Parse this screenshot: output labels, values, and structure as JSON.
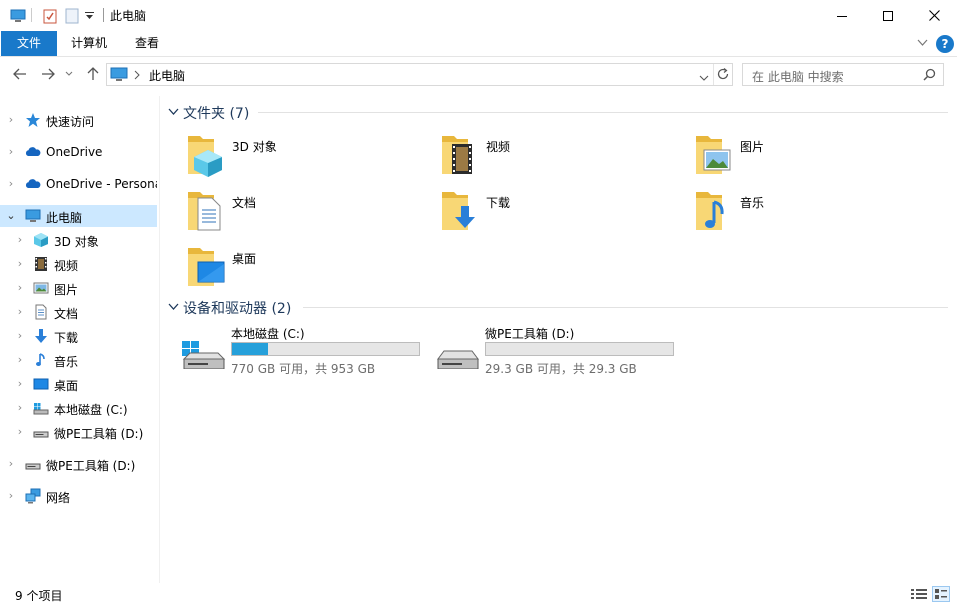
{
  "window": {
    "title": "此电脑",
    "controls": [
      "minimize-icon",
      "maximize-icon",
      "close-icon"
    ]
  },
  "ribbon": {
    "tabs": [
      {
        "label": "文件",
        "active": true
      },
      {
        "label": "计算机",
        "active": false
      },
      {
        "label": "查看",
        "active": false
      }
    ],
    "help_label": "?"
  },
  "address": {
    "location": "此电脑",
    "search_placeholder": "在 此电脑 中搜索"
  },
  "navpane": {
    "items": [
      {
        "label": "快速访问",
        "icon": "star-icon"
      },
      {
        "label": "OneDrive",
        "icon": "cloud-icon"
      },
      {
        "label": "OneDrive - Personal",
        "icon": "cloud-icon"
      },
      {
        "label": "此电脑",
        "icon": "computer-icon",
        "selected": true
      },
      {
        "label": "3D 对象",
        "icon": "cube-icon"
      },
      {
        "label": "视频",
        "icon": "film-icon"
      },
      {
        "label": "图片",
        "icon": "picture-icon"
      },
      {
        "label": "文档",
        "icon": "document-icon"
      },
      {
        "label": "下载",
        "icon": "download-arrow-icon"
      },
      {
        "label": "音乐",
        "icon": "music-note-icon"
      },
      {
        "label": "桌面",
        "icon": "desktop-icon"
      },
      {
        "label": "本地磁盘 (C:)",
        "icon": "windows-drive-icon"
      },
      {
        "label": "微PE工具箱 (D:)",
        "icon": "drive-icon"
      },
      {
        "label": "微PE工具箱 (D:)",
        "icon": "drive-icon"
      },
      {
        "label": "网络",
        "icon": "network-icon"
      }
    ]
  },
  "folders_group": {
    "header": "文件夹 (7)",
    "items": [
      {
        "label": "3D 对象",
        "overlay": "cube"
      },
      {
        "label": "视频",
        "overlay": "film"
      },
      {
        "label": "图片",
        "overlay": "picture"
      },
      {
        "label": "文档",
        "overlay": "document"
      },
      {
        "label": "下载",
        "overlay": "download"
      },
      {
        "label": "音乐",
        "overlay": "music"
      },
      {
        "label": "桌面",
        "overlay": "desktop"
      }
    ]
  },
  "drives_group": {
    "header": "设备和驱动器 (2)",
    "items": [
      {
        "label": "本地磁盘 (C:)",
        "size_text": "770 GB 可用，共 953 GB",
        "used_fraction": 0.19,
        "icon": "windows-drive-icon"
      },
      {
        "label": "微PE工具箱 (D:)",
        "size_text": "29.3 GB 可用，共 29.3 GB",
        "used_fraction": 0.0,
        "icon": "drive-icon"
      }
    ]
  },
  "status": {
    "item_count": "9 个项目"
  },
  "colors": {
    "accent": "#1979ca",
    "selection": "#cce8ff",
    "group_header": "#1e395b",
    "drive_bar_fill": "#26a0da",
    "folder_yellow": "#f8d775"
  }
}
